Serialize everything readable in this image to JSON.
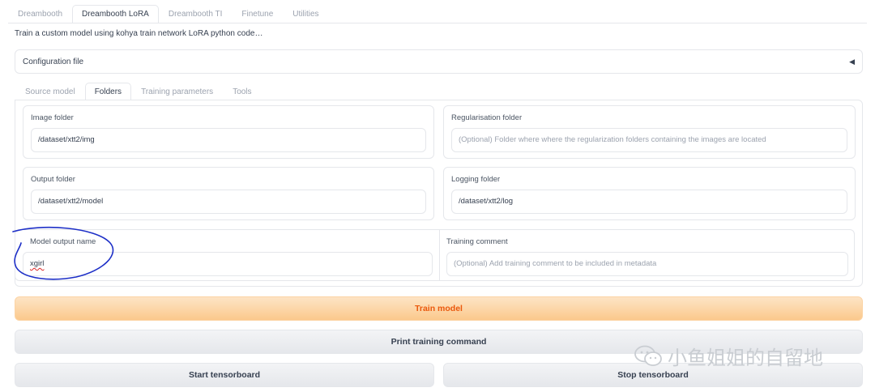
{
  "top_tabs": [
    "Dreambooth",
    "Dreambooth LoRA",
    "Dreambooth TI",
    "Finetune",
    "Utilities"
  ],
  "active_top_tab": "Dreambooth LoRA",
  "description": "Train a custom model using kohya train network LoRA python code…",
  "config": {
    "label": "Configuration file",
    "caret": "◀"
  },
  "sub_tabs": [
    "Source model",
    "Folders",
    "Training parameters",
    "Tools"
  ],
  "active_sub_tab": "Folders",
  "fields": {
    "image_folder": {
      "label": "Image folder",
      "value": "/dataset/xtt2/img"
    },
    "reg_folder": {
      "label": "Regularisation folder",
      "placeholder": "(Optional) Folder where where the regularization folders containing the images are located"
    },
    "output_folder": {
      "label": "Output folder",
      "value": "/dataset/xtt2/model"
    },
    "logging_folder": {
      "label": "Logging folder",
      "value": "/dataset/xtt2/log"
    },
    "model_output_name": {
      "label": "Model output name",
      "value": "xgirl"
    },
    "training_comment": {
      "label": "Training comment",
      "placeholder": "(Optional) Add training comment to be included in metadata"
    }
  },
  "buttons": {
    "train": "Train model",
    "print": "Print training command",
    "start_tb": "Start tensorboard",
    "stop_tb": "Stop tensorboard"
  },
  "watermark": {
    "text": "小鱼姐姐的自留地",
    "icon": "wechat-icon"
  },
  "colors": {
    "accent": "#ea580c",
    "annotation": "#1d2fc7",
    "border": "#e5e7eb"
  }
}
